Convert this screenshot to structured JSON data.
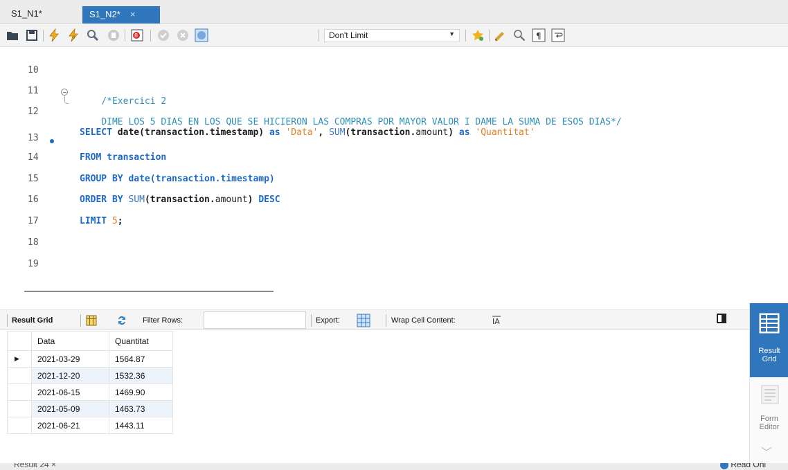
{
  "tabs": [
    {
      "label": "S1_N1*",
      "active": false
    },
    {
      "label": "S1_N2*",
      "active": true,
      "close": "×"
    }
  ],
  "toolbar": {
    "limit_select": "Don't Limit",
    "icons": [
      "open-folder-icon",
      "save-icon",
      "execute-icon",
      "execute-current-icon",
      "explain-icon",
      "stop-icon",
      "toggle-error-icon",
      "commit-icon",
      "rollback-icon",
      "autocommit-icon",
      "beautify-icon",
      "bookmark-icon",
      "find-icon",
      "invisible-chars-icon",
      "word-wrap-icon"
    ]
  },
  "editor": {
    "lines": [
      {
        "n": "10"
      },
      {
        "n": "11",
        "tokens": [
          {
            "t": "comment",
            "v": "/*Exercici 2"
          }
        ]
      },
      {
        "n": "12",
        "tokens": [
          {
            "t": "comment",
            "v": "DIME LOS 5 DIAS EN LOS QUE SE HICIERON LAS COMPRAS POR MAYOR VALOR I DAME LA SUMA DE ESOS DIAS*/"
          }
        ]
      },
      {
        "n": "13",
        "tokens": [
          {
            "t": "kw",
            "v": "SELECT "
          },
          {
            "t": "plain",
            "v": "date(transaction.timestamp) "
          },
          {
            "t": "kw",
            "v": "as "
          },
          {
            "t": "str",
            "v": "'Data'"
          },
          {
            "t": "plain",
            "v": ", "
          },
          {
            "t": "fn",
            "v": "SUM"
          },
          {
            "t": "plain",
            "v": "(transaction."
          },
          {
            "t": "plainn",
            "v": "amount"
          },
          {
            "t": "plain",
            "v": ") "
          },
          {
            "t": "kw",
            "v": "as "
          },
          {
            "t": "str",
            "v": "'Quantitat'"
          }
        ]
      },
      {
        "n": "14",
        "tokens": [
          {
            "t": "kw",
            "v": "FROM transaction"
          }
        ]
      },
      {
        "n": "15",
        "tokens": [
          {
            "t": "kw",
            "v": "GROUP BY date(transaction.timestamp)"
          }
        ]
      },
      {
        "n": "16",
        "tokens": [
          {
            "t": "kw",
            "v": "ORDER BY "
          },
          {
            "t": "fn",
            "v": "SUM"
          },
          {
            "t": "plain",
            "v": "(transaction."
          },
          {
            "t": "plainn",
            "v": "amount"
          },
          {
            "t": "plain",
            "v": ") "
          },
          {
            "t": "kw",
            "v": "DESC"
          }
        ]
      },
      {
        "n": "17",
        "tokens": [
          {
            "t": "kw",
            "v": "LIMIT "
          },
          {
            "t": "num",
            "v": "5"
          },
          {
            "t": "plain",
            "v": ";"
          }
        ]
      },
      {
        "n": "18"
      },
      {
        "n": "19"
      }
    ]
  },
  "result_toolbar": {
    "result_grid": "Result Grid",
    "filter_rows": "Filter Rows:",
    "export": "Export:",
    "wrap": "Wrap Cell Content:"
  },
  "grid": {
    "columns": [
      "Data",
      "Quantitat"
    ],
    "rows": [
      [
        "2021-03-29",
        "1564.87"
      ],
      [
        "2021-12-20",
        "1532.36"
      ],
      [
        "2021-06-15",
        "1469.90"
      ],
      [
        "2021-05-09",
        "1463.73"
      ],
      [
        "2021-06-21",
        "1443.11"
      ]
    ]
  },
  "side_panel": {
    "result_grid_line1": "Result",
    "result_grid_line2": "Grid",
    "form_editor_line1": "Form",
    "form_editor_line2": "Editor"
  },
  "bottom": {
    "result_tab": "Result 24",
    "result_tab_close": "×",
    "status": "Read Onl"
  }
}
